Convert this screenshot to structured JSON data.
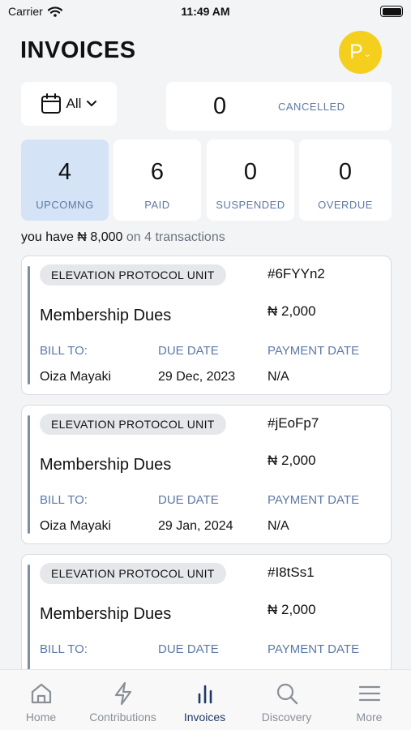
{
  "status_bar": {
    "carrier": "Carrier",
    "time": "11:49 AM"
  },
  "header": {
    "title": "INVOICES",
    "avatar_initial": "P",
    "avatar_color": "#f5cf1e"
  },
  "filter": {
    "label": "All"
  },
  "cancelled": {
    "count": "0",
    "label": "CANCELLED"
  },
  "stats": [
    {
      "count": "4",
      "label": "UPCOMNG",
      "active": true
    },
    {
      "count": "6",
      "label": "PAID",
      "active": false
    },
    {
      "count": "0",
      "label": "SUSPENDED",
      "active": false
    },
    {
      "count": "0",
      "label": "OVERDUE",
      "active": false
    }
  ],
  "summary": {
    "prefix": "you have ₦ 8,000",
    "suffix": "on 4 transactions"
  },
  "invoices": [
    {
      "unit": "ELEVATION PROTOCOL UNIT",
      "id": "#6FYYn2",
      "title": "Membership Dues",
      "amount": "₦ 2,000",
      "bill_to_label": "BILL TO:",
      "due_date_label": "DUE DATE",
      "payment_date_label": "PAYMENT DATE",
      "bill_to": "Oiza Mayaki",
      "due_date": "29 Dec, 2023",
      "payment_date": "N/A"
    },
    {
      "unit": "ELEVATION PROTOCOL UNIT",
      "id": "#jEoFp7",
      "title": "Membership Dues",
      "amount": "₦ 2,000",
      "bill_to_label": "BILL TO:",
      "due_date_label": "DUE DATE",
      "payment_date_label": "PAYMENT DATE",
      "bill_to": "Oiza Mayaki",
      "due_date": "29 Jan, 2024",
      "payment_date": "N/A"
    },
    {
      "unit": "ELEVATION PROTOCOL UNIT",
      "id": "#I8tSs1",
      "title": "Membership Dues",
      "amount": "₦ 2,000",
      "bill_to_label": "BILL TO:",
      "due_date_label": "DUE DATE",
      "payment_date_label": "PAYMENT DATE"
    }
  ],
  "tabs": [
    {
      "label": "Home",
      "icon": "home-icon"
    },
    {
      "label": "Contributions",
      "icon": "lightning-icon"
    },
    {
      "label": "Invoices",
      "icon": "bar-chart-icon",
      "active": true
    },
    {
      "label": "Discovery",
      "icon": "search-icon"
    },
    {
      "label": "More",
      "icon": "menu-icon"
    }
  ],
  "colors": {
    "accent": "#5d79a6",
    "active_stat_bg": "#d4e3f6",
    "active_tab": "#1f3a63",
    "background": "#f3f4f6"
  }
}
